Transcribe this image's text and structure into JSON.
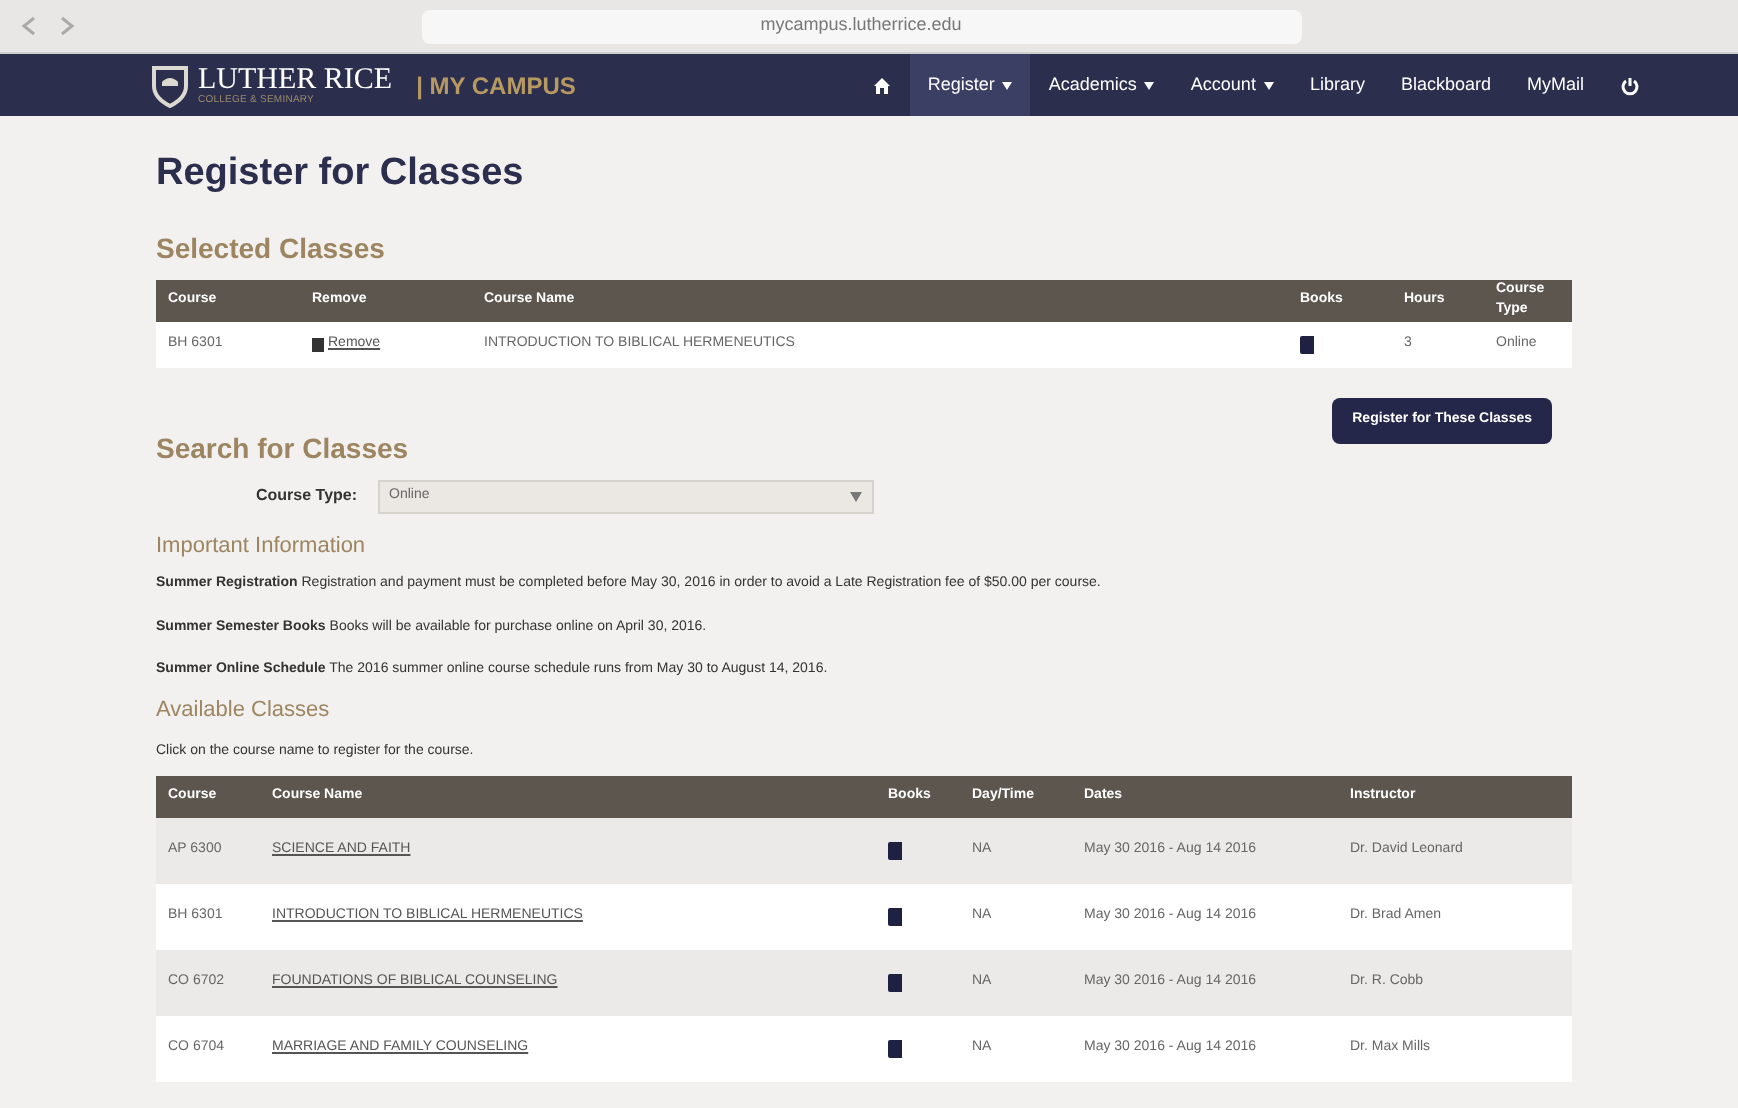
{
  "browser": {
    "address": "mycampus.lutherrice.edu"
  },
  "header": {
    "logo_name": "LUTHER RICE",
    "logo_sub": "COLLEGE & SEMINARY",
    "portal": "| MY CAMPUS",
    "nav": [
      {
        "kind": "home",
        "selected": false
      },
      {
        "kind": "menu",
        "label": "Register",
        "selected": true
      },
      {
        "kind": "menu",
        "label": "Academics",
        "selected": false
      },
      {
        "kind": "menu",
        "label": "Account",
        "selected": false
      },
      {
        "kind": "link",
        "label": "Library",
        "selected": false
      },
      {
        "kind": "link",
        "label": "Blackboard",
        "selected": false
      },
      {
        "kind": "link",
        "label": "MyMail",
        "selected": false
      },
      {
        "kind": "logout",
        "selected": false
      }
    ]
  },
  "title": "Register for Classes",
  "selected_classes": {
    "heading": "Selected Classes",
    "columns": [
      "Course",
      "Remove",
      "Course Name",
      "Books",
      "Hours",
      "Course Type"
    ],
    "rows": [
      {
        "course": "BH 6301",
        "remove": "Remove",
        "name": "INTRODUCTION TO BIBLICAL HERMENEUTICS",
        "hours": "3",
        "type": "Online"
      }
    ],
    "button": "Register for These Classes"
  },
  "search": {
    "heading": "Search for Classes",
    "label": "Course Type:",
    "value": "Online"
  },
  "important": {
    "heading": "Important Information",
    "items": [
      {
        "title": "Summer Registration",
        "text": "Registration and payment must be completed before May 30, 2016 in order to avoid a Late Registration fee of $50.00 per course."
      },
      {
        "title": "Summer Semester Books",
        "text": "Books will be available for purchase online on April 30, 2016."
      },
      {
        "title": "Summer Online Schedule",
        "text": "The 2016 summer online course schedule runs from May 30 to August 14, 2016."
      }
    ]
  },
  "available": {
    "heading": "Available Classes",
    "note": "Click on the course name to register for the course.",
    "columns": [
      "Course",
      "Course Name",
      "Books",
      "Day/Time",
      "Dates",
      "Instructor"
    ],
    "rows": [
      {
        "course": "AP 6300",
        "name": "SCIENCE AND FAITH",
        "day_time": "NA",
        "dates": "May 30 2016 - Aug 14 2016",
        "instructor": "Dr. David Leonard"
      },
      {
        "course": "BH 6301",
        "name": "INTRODUCTION TO BIBLICAL HERMENEUTICS",
        "day_time": "NA",
        "dates": "May 30 2016 - Aug 14 2016",
        "instructor": "Dr. Brad Amen"
      },
      {
        "course": "CO 6702",
        "name": "FOUNDATIONS OF BIBLICAL COUNSELING",
        "day_time": "NA",
        "dates": "May 30 2016 - Aug 14 2016",
        "instructor": "Dr. R. Cobb"
      },
      {
        "course": "CO 6704",
        "name": "MARRIAGE AND FAMILY COUNSELING",
        "day_time": "NA",
        "dates": "May 30 2016 - Aug 14 2016",
        "instructor": "Dr. Max Mills"
      }
    ]
  }
}
